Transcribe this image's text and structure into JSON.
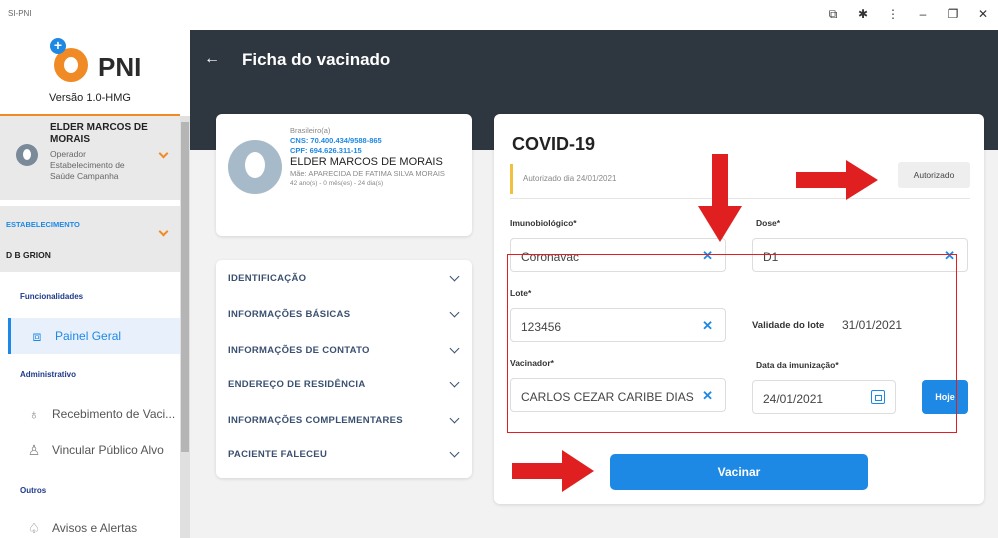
{
  "window": {
    "title": "SI-PNI"
  },
  "sidebar": {
    "logo_text": "PNI",
    "version": "Versão 1.0-HMG",
    "user": {
      "name": "ELDER MARCOS DE MORAIS",
      "role": "Operador Estabelecimento de Saúde Campanha"
    },
    "establishment": {
      "label": "ESTABELECIMENTO",
      "value": "D B GRION"
    },
    "sections": {
      "funcionalidades": "Funcionalidades",
      "administrativo": "Administrativo",
      "outros": "Outros"
    },
    "items": {
      "painel": "Painel Geral",
      "recebimento": "Recebimento de Vaci...",
      "vincular": "Vincular Público Alvo",
      "avisos": "Avisos e Alertas"
    }
  },
  "header": {
    "title": "Ficha do vacinado"
  },
  "patient": {
    "nationality": "Brasileiro(a)",
    "cns": "CNS: 70.400.434/9588-865",
    "cpf": "CPF: 694.626.311-15",
    "name": "ELDER MARCOS DE MORAIS",
    "mother": "Mãe: APARECIDA DE FATIMA SILVA MORAIS",
    "age": "42 ano(s) - 0 mês(es) - 24 dia(s)"
  },
  "accordion": [
    "IDENTIFICAÇÃO",
    "INFORMAÇÕES BÁSICAS",
    "INFORMAÇÕES DE CONTATO",
    "ENDEREÇO DE RESIDÊNCIA",
    "INFORMAÇÕES COMPLEMENTARES",
    "PACIENTE FALECEU"
  ],
  "form": {
    "title": "COVID-19",
    "authorized_text": "Autorizado dia 24/01/2021",
    "authorized_button": "Autorizado",
    "imunobiologico_label": "Imunobiológico*",
    "imunobiologico_value": "Coronavac",
    "dose_label": "Dose*",
    "dose_value": "D1",
    "lote_label": "Lote*",
    "lote_value": "123456",
    "validade_label": "Validade do lote",
    "validade_value": "31/01/2021",
    "vacinador_label": "Vacinador*",
    "vacinador_value": "CARLOS CEZAR CARIBE DIAS",
    "data_label": "Data da imunização*",
    "data_value": "24/01/2021",
    "hoje_button": "Hoje",
    "vacinar_button": "Vacinar"
  },
  "colors": {
    "primary": "#1e88e5",
    "header": "#2e3640",
    "accent": "#f08a24",
    "annotation": "#e02020"
  }
}
